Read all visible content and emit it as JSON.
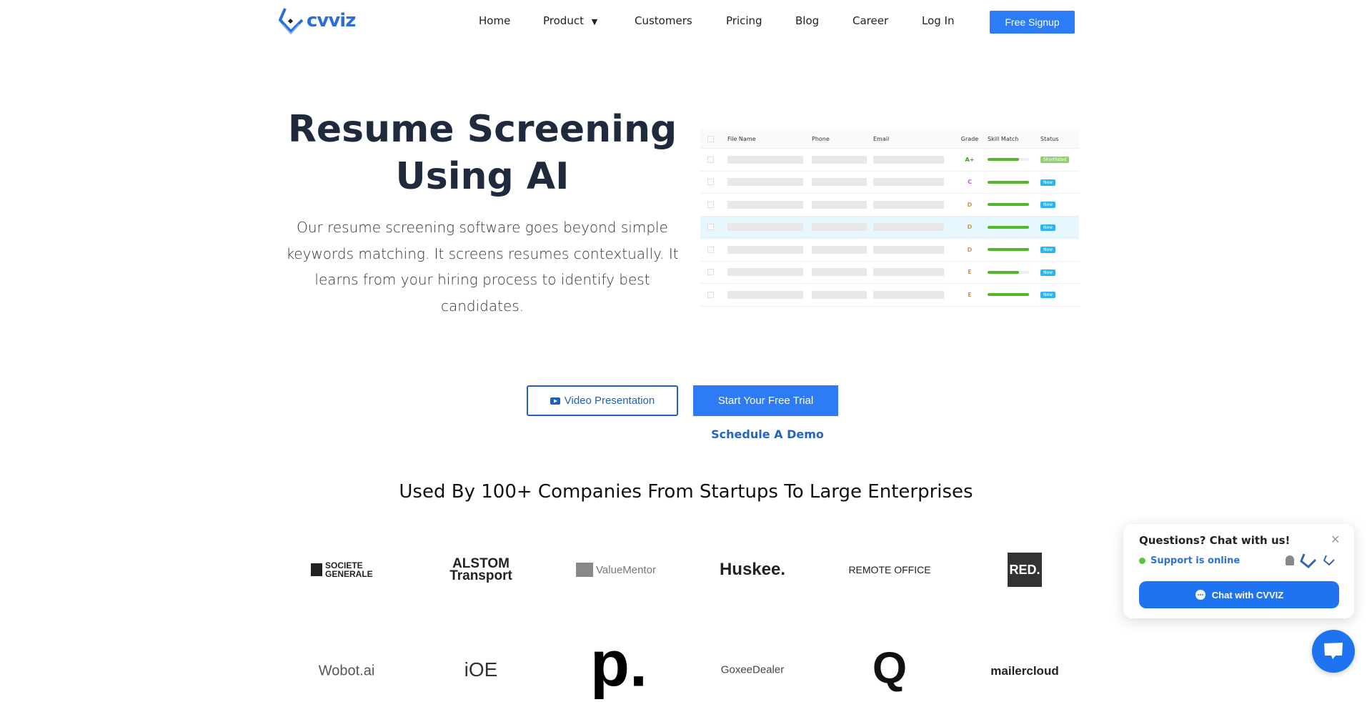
{
  "brand": {
    "name": "cvviz",
    "accent": "#2e7bf6"
  },
  "nav": {
    "items": [
      "Home",
      "Product",
      "Customers",
      "Pricing",
      "Blog",
      "Career",
      "Log In"
    ],
    "signup": "Free Signup"
  },
  "hero": {
    "title_line1": "Resume Screening",
    "title_line2": "Using AI",
    "description": "Our resume screening software goes beyond simple keywords matching. It screens resumes contextually. It learns from your hiring process to identify best candidates."
  },
  "table": {
    "headers": [
      "File Name",
      "Phone",
      "Email",
      "Grade",
      "Skill Match",
      "Status"
    ],
    "rows": [
      {
        "grade": "A+",
        "grade_color": "#3aa420",
        "match": 0.75,
        "status": "Shortlisted"
      },
      {
        "grade": "C",
        "grade_color": "#c558d9",
        "match": 1,
        "status": "New"
      },
      {
        "grade": "D",
        "grade_color": "#c9985a",
        "match": 1,
        "status": "New"
      },
      {
        "grade": "D",
        "grade_color": "#c9985a",
        "match": 1,
        "status": "New"
      },
      {
        "grade": "D",
        "grade_color": "#c9985a",
        "match": 1,
        "status": "New"
      },
      {
        "grade": "E",
        "grade_color": "#c9985a",
        "match": 0.75,
        "status": "New"
      },
      {
        "grade": "E",
        "grade_color": "#c9985a",
        "match": 1,
        "status": "New"
      }
    ]
  },
  "cta": {
    "video": "Video Presentation",
    "trial": "Start Your Free Trial",
    "demo": "Schedule A Demo"
  },
  "companies": {
    "heading": "Used By 100+ Companies From Startups To Large Enterprises",
    "logos": [
      "SOCIETE GENERALE",
      "ALSTOM Transport",
      "ValueMentor",
      "Huskee.",
      "REMOTE OFFICE",
      "RED.",
      "Wobot.ai",
      "iOE",
      "p.",
      "GoxeeDealer",
      "Q",
      "mailercloud"
    ]
  },
  "chat": {
    "title": "Questions? Chat with us!",
    "status": "Support is online",
    "button": "Chat with CVVIZ"
  }
}
